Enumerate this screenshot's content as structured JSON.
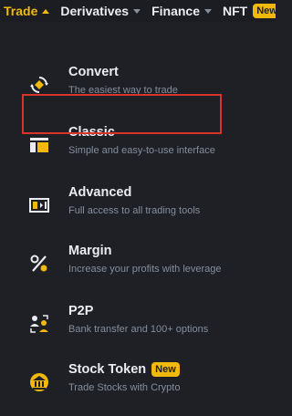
{
  "nav": {
    "items": [
      {
        "label": "Trade",
        "active": true
      },
      {
        "label": "Derivatives",
        "active": false
      },
      {
        "label": "Finance",
        "active": false
      },
      {
        "label": "NFT",
        "active": false,
        "badge": "New"
      }
    ]
  },
  "menu": {
    "items": [
      {
        "title": "Convert",
        "description": "The easiest way to trade",
        "icon": "convert-icon"
      },
      {
        "title": "Classic",
        "description": "Simple and easy-to-use interface",
        "icon": "classic-layout-icon",
        "highlighted": true
      },
      {
        "title": "Advanced",
        "description": "Full access to all trading tools",
        "icon": "advanced-layout-icon"
      },
      {
        "title": "Margin",
        "description": "Increase your profits with leverage",
        "icon": "percent-icon"
      },
      {
        "title": "P2P",
        "description": "Bank transfer and 100+ options",
        "icon": "p2p-users-icon"
      },
      {
        "title": "Stock Token",
        "description": "Trade Stocks with Crypto",
        "icon": "stock-token-icon",
        "badge": "New"
      }
    ]
  },
  "colors": {
    "accent": "#f0b90b",
    "background": "#1e2026",
    "text_primary": "#eaecef",
    "text_secondary": "#848e9c",
    "highlight_border": "#d9342b"
  }
}
